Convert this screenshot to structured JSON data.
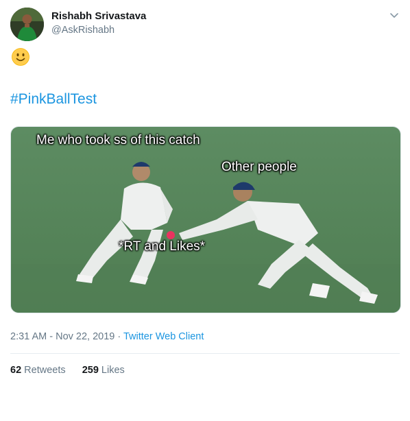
{
  "tweet": {
    "author_name": "Rishabh Srivastava",
    "author_handle": "@AskRishabh",
    "emoji": "🙂",
    "hashtag": "#PinkBallTest",
    "media": {
      "caption_top": "Me who took ss of this catch",
      "caption_right": "Other people",
      "caption_center": "*RT and Likes*"
    },
    "time": "2:31 AM",
    "date": "Nov 22, 2019",
    "separator": " · ",
    "source": "Twitter Web Client",
    "stats": {
      "retweets_count": "62",
      "retweets_label": "Retweets",
      "likes_count": "259",
      "likes_label": "Likes"
    }
  },
  "colors": {
    "link": "#1b95e0",
    "secondary_text": "#657786",
    "pitch_green": "#5c8d5f"
  }
}
